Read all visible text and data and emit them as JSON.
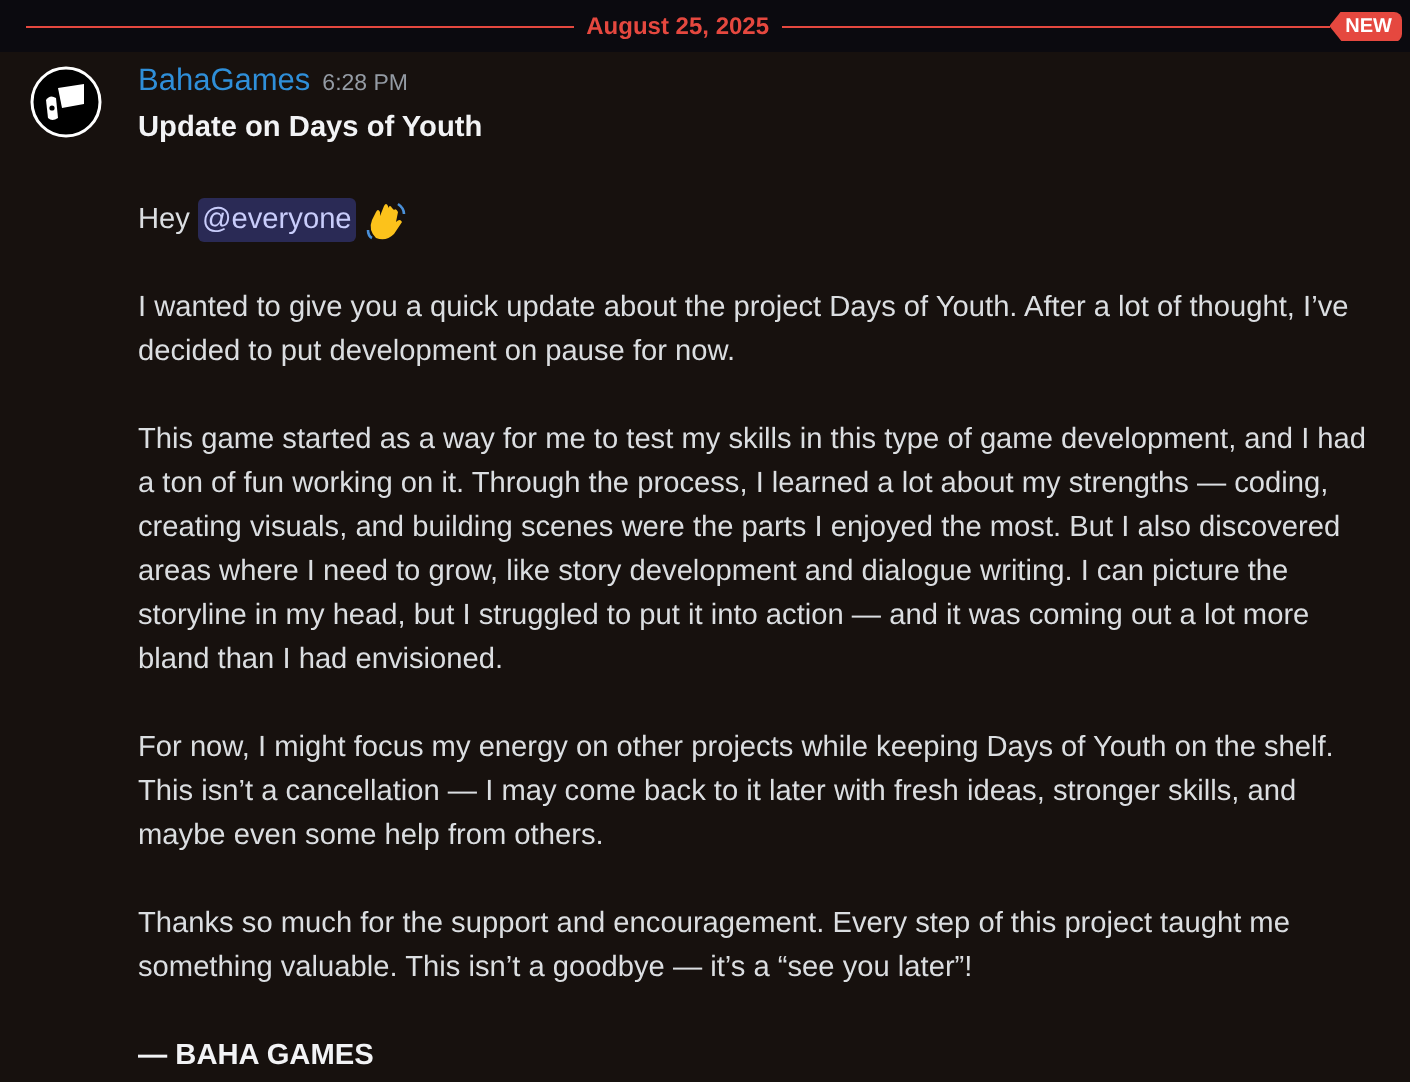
{
  "divider": {
    "date": "August 25, 2025",
    "badge": "NEW"
  },
  "message": {
    "author": "BahaGames",
    "time": "6:28 PM",
    "title": "Update on Days of Youth",
    "greeting": "Hey",
    "mention": "@everyone",
    "paragraphs": [
      "I wanted to give you a quick update about the project Days of Youth. After a lot of thought, I’ve decided to put development on pause for now.",
      "This game started as a way for me to test my skills in this type of game development, and I had a ton of fun working on it. Through the process, I learned a lot about my strengths — coding, creating visuals, and building scenes were the parts I enjoyed the most. But I also discovered areas where I need to grow, like story development and dialogue writing. I can picture the storyline in my head, but I struggled to put it into action — and it was coming out a lot more bland than I had envisioned.",
      "For now, I might focus my energy on other projects while keeping Days of Youth on the shelf. This isn’t a cancellation — I may come back to it later with fresh ideas, stronger skills, and maybe even some help from others.",
      "Thanks so much for the support and encouragement. Every step of this project taught me something valuable. This isn’t a goodbye — it’s a “see you later”!"
    ],
    "signature": "— BAHA GAMES"
  }
}
